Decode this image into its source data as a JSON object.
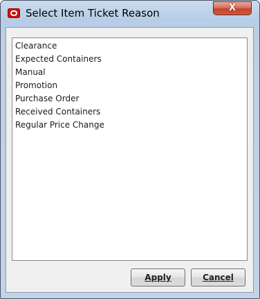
{
  "dialog": {
    "title": "Select Item Ticket Reason",
    "close_glyph": "X"
  },
  "reasons": {
    "items": [
      {
        "label": "Clearance"
      },
      {
        "label": "Expected Containers"
      },
      {
        "label": "Manual"
      },
      {
        "label": "Promotion"
      },
      {
        "label": "Purchase Order"
      },
      {
        "label": "Received Containers"
      },
      {
        "label": "Regular Price Change"
      }
    ]
  },
  "buttons": {
    "apply_label": "Apply",
    "cancel_label": "Cancel"
  },
  "colors": {
    "close_button": "#c4422c",
    "app_icon": "#d01010",
    "frame": "#b7cde6"
  }
}
